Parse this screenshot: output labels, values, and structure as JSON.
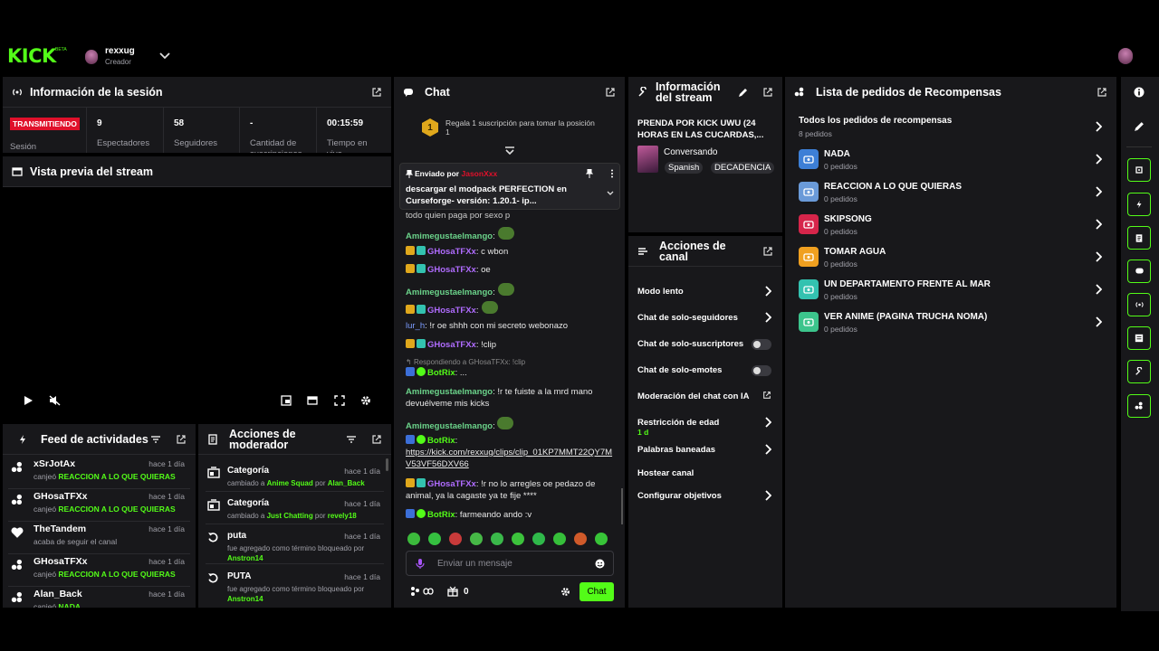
{
  "top": {
    "logo": "KICK",
    "logo_tag": "BETA",
    "user": "rexxug",
    "role": "Creador"
  },
  "session": {
    "title": "Información de la sesión",
    "status": "TRANSMITIENDO",
    "status_label": "Sesión",
    "viewers": "9",
    "viewers_label": "Espectadores",
    "followers": "58",
    "followers_label": "Seguidores",
    "subs": "-",
    "subs_label": "Cantidad de suscripciones",
    "time": "00:15:59",
    "time_label": "Tiempo en vivo"
  },
  "preview": {
    "title": "Vista previa del stream"
  },
  "feed": {
    "title": "Feed de actividades",
    "items": [
      {
        "name": "xSrJotAx",
        "pre": "canjeó ",
        "highlight": "REACCION A LO QUE QUIERAS",
        "time": "hace 1 día",
        "icon": "reward-icon"
      },
      {
        "name": "GHosaTFXx",
        "pre": "canjeó ",
        "highlight": "REACCION A LO QUE QUIERAS",
        "time": "hace 1 día",
        "icon": "reward-icon"
      },
      {
        "name": "TheTandem",
        "pre": "acaba de seguir el canal",
        "highlight": "",
        "time": "hace 1 día",
        "icon": "heart-icon"
      },
      {
        "name": "GHosaTFXx",
        "pre": "canjeó ",
        "highlight": "REACCION A LO QUE QUIERAS",
        "time": "hace 1 día",
        "icon": "reward-icon"
      },
      {
        "name": "Alan_Back",
        "pre": "canjeó ",
        "highlight": "NADA",
        "time": "hace 1 día",
        "icon": "reward-icon"
      }
    ]
  },
  "modactions": {
    "title": "Acciones de moderador",
    "items": [
      {
        "name": "Categoría",
        "l1a": "cambiado a ",
        "l1b": "Anime Squad",
        "l1c": " por ",
        "l1d": "Alan_Back",
        "l2": "",
        "time": "hace 1 día"
      },
      {
        "name": "Categoría",
        "l1a": "cambiado a ",
        "l1b": "Just Chatting",
        "l1c": " por ",
        "l1d": "revely18",
        "l2": "",
        "time": "hace 1 día"
      },
      {
        "name": "puta",
        "l1a": "fue agregado como término bloqueado por",
        "l1b": "",
        "l1c": "",
        "l1d": "",
        "l2": "Anstron14",
        "time": "hace 1 día"
      },
      {
        "name": "PUTA",
        "l1a": "fue agregado como término bloqueado por",
        "l1b": "",
        "l1c": "",
        "l1d": "",
        "l2": "Anstron14",
        "time": "hace 1 día"
      }
    ]
  },
  "chat": {
    "title": "Chat",
    "gift_text": "Regala 1 suscripción para tomar la posición 1",
    "gift_rank": "1",
    "pinned_by": "Enviado por",
    "pinned_user": "JasonXxx",
    "pinned_msg": "descargar el modpack PERFECTION en Curseforge- versión: 1.20.1- ip...",
    "cut_line": "todo quien paga por sexo p",
    "messages": [
      {
        "user": "Amimegustaelmango",
        "sep": ":",
        "text": "",
        "ucls": "green",
        "badges": 0,
        "emote": true
      },
      {
        "user": "GHosaTFXx",
        "sep": ": ",
        "text": "c wbon",
        "ucls": "purple",
        "badges": 2,
        "emote": false
      },
      {
        "user": "GHosaTFXx",
        "sep": ": ",
        "text": "oe",
        "ucls": "purple",
        "badges": 2,
        "emote": false
      },
      {
        "user": "Amimegustaelmango",
        "sep": ":",
        "text": "",
        "ucls": "green",
        "badges": 0,
        "emote": true
      },
      {
        "user": "GHosaTFXx",
        "sep": ":",
        "text": "",
        "ucls": "purple",
        "badges": 2,
        "emote": true
      },
      {
        "user": "lur_h",
        "sep": ": ",
        "text": "!r oe shhh con mi secreto webonazo",
        "ucls": "blue",
        "badges": 0,
        "emote": false
      },
      {
        "user": "GHosaTFXx",
        "sep": ": ",
        "text": "!clip",
        "ucls": "purple",
        "badges": 2,
        "emote": false
      }
    ],
    "reply_to": "Respondiendo a GHosaTFXx: !clip",
    "botrix1_user": "BotRix",
    "botrix1_text": ": ...",
    "msg_a_user": "Amimegustaelmango",
    "msg_a_text": ": !r te fuiste a la mrd mano devuélveme mis kicks",
    "msg_b_user": "Amimegustaelmango",
    "botrix2_user": "BotRix",
    "botrix2_link": "https://kick.com/rexxug/clips/clip_01KP7MMT22QY7MV53VF56DXV66",
    "msg_c_user": "GHosaTFXx",
    "msg_c_text": ": !r no lo arregles oe pedazo de animal, ya la cagaste ya te fije ****",
    "botrix3_user": "BotRix",
    "botrix3_text": ": farmeando ando :v",
    "input_placeholder": "Enviar un mensaje",
    "points": "0",
    "send_label": "Chat"
  },
  "streaminfo": {
    "title": "Información del stream",
    "stream_title": "PRENDA POR KICK UWU (24 HORAS EN LAS CUCARDAS,...",
    "category": "Conversando",
    "tags": [
      "Spanish",
      "DECADENCIA"
    ]
  },
  "channel": {
    "title": "Acciones de canal",
    "items": [
      {
        "label": "Modo lento",
        "control": "chevron",
        "sub": ""
      },
      {
        "label": "Chat de solo-seguidores",
        "control": "chevron",
        "sub": ""
      },
      {
        "label": "Chat de solo-suscriptores",
        "control": "toggle",
        "sub": ""
      },
      {
        "label": "Chat de solo-emotes",
        "control": "toggle",
        "sub": ""
      },
      {
        "label": "Moderación del chat con IA",
        "control": "external",
        "sub": ""
      },
      {
        "label": "Restricción de edad",
        "control": "chevron",
        "sub": "1 d"
      },
      {
        "label": "Palabras baneadas",
        "control": "chevron",
        "sub": ""
      },
      {
        "label": "Hostear canal",
        "control": "none",
        "sub": ""
      },
      {
        "label": "Configurar objetivos",
        "control": "chevron",
        "sub": ""
      }
    ]
  },
  "rewards": {
    "title": "Lista de pedidos de Recompensas",
    "all_label": "Todos los pedidos de recompensas",
    "all_count": "8 pedidos",
    "items": [
      {
        "name": "NADA",
        "count": "0 pedidos",
        "color": "#3d7fd6"
      },
      {
        "name": "REACCION A LO QUE QUIERAS",
        "count": "0 pedidos",
        "color": "#6a9ad8"
      },
      {
        "name": "SKIPSONG",
        "count": "0 pedidos",
        "color": "#d6254a"
      },
      {
        "name": "TOMAR AGUA",
        "count": "0 pedidos",
        "color": "#f0a020"
      },
      {
        "name": "UN DEPARTAMENTO FRENTE AL MAR",
        "count": "0 pedidos",
        "color": "#33c2b0"
      },
      {
        "name": "VER ANIME (PAGINA TRUCHA NOMA)",
        "count": "0 pedidos",
        "color": "#3cc48c"
      }
    ]
  },
  "colors": {
    "accent": "#53fc18",
    "panel": "#18181b",
    "live": "#e0102a"
  }
}
